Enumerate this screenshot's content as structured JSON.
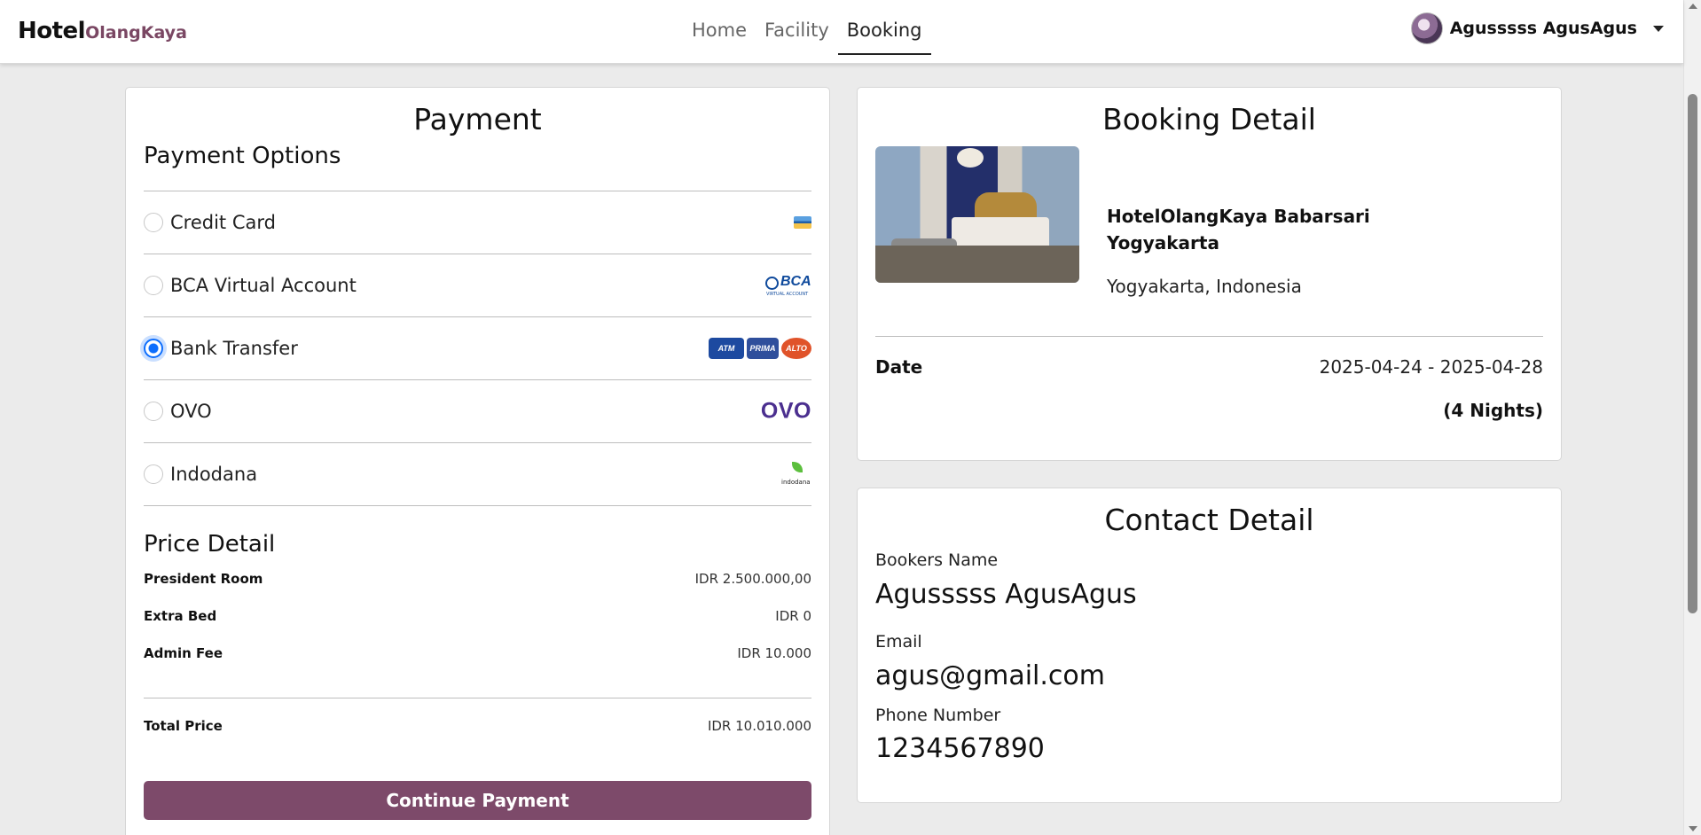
{
  "navbar": {
    "brand_main": "Hotel",
    "brand_accent": "OlangKaya",
    "links": [
      "Home",
      "Facility",
      "Booking"
    ],
    "active_link": "Booking",
    "user_name": "Agusssss AgusAgus"
  },
  "payment": {
    "title": "Payment",
    "options_title": "Payment Options",
    "options": [
      {
        "label": "Credit Card",
        "logo": "credit-card-icon",
        "selected": false
      },
      {
        "label": "BCA Virtual Account",
        "logo": "bca-logo",
        "logo_text": "BCA",
        "logo_subtext": "VIRTUAL ACCOUNT",
        "selected": false
      },
      {
        "label": "Bank Transfer",
        "logo": "atm-prima-alto-logos",
        "logo_text": [
          "ATM",
          "PRIMA",
          "ALTO"
        ],
        "selected": true
      },
      {
        "label": "OVO",
        "logo": "ovo-logo",
        "logo_text": "OVO",
        "selected": false
      },
      {
        "label": "Indodana",
        "logo": "indodana-logo",
        "logo_text": "indodana",
        "selected": false
      }
    ],
    "price_title": "Price Detail",
    "prices": [
      {
        "label": "President Room",
        "value": "IDR 2.500.000,00"
      },
      {
        "label": "Extra Bed",
        "value": "IDR 0"
      },
      {
        "label": "Admin Fee",
        "value": "IDR 10.000"
      }
    ],
    "total": {
      "label": "Total Price",
      "value": "IDR 10.010.000"
    },
    "continue_label": "Continue Payment",
    "accent_color": "#7d4a6a"
  },
  "booking": {
    "title": "Booking Detail",
    "hotel_name": "HotelOlangKaya Babarsari Yogyakarta",
    "location": "Yogyakarta, Indonesia",
    "date_label": "Date",
    "date_value": "2025-04-24 - 2025-04-28",
    "nights": "(4 Nights)"
  },
  "contact": {
    "title": "Contact Detail",
    "name_label": "Bookers Name",
    "name_value": "Agusssss AgusAgus",
    "email_label": "Email",
    "email_value": "agus@gmail.com",
    "phone_label": "Phone Number",
    "phone_value": "1234567890"
  }
}
